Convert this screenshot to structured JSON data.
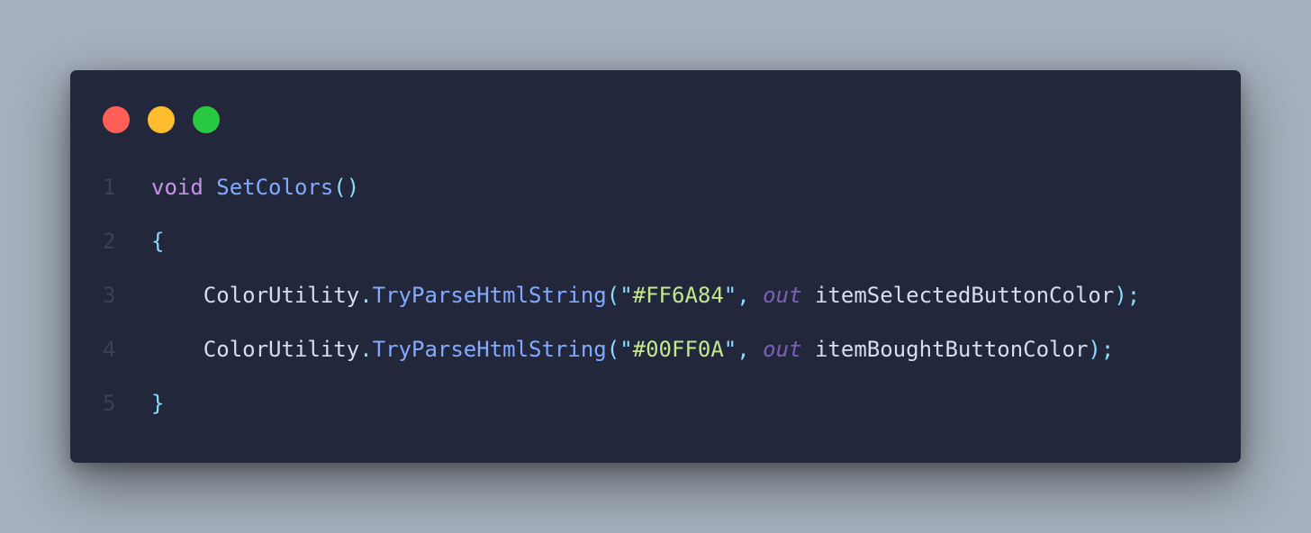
{
  "window": {
    "dots": [
      {
        "name": "close-dot",
        "color": "#ff5f57"
      },
      {
        "name": "minimize-dot",
        "color": "#febc2e"
      },
      {
        "name": "maximize-dot",
        "color": "#28c840"
      }
    ]
  },
  "colors": {
    "background": "#a5b0bc",
    "window": "#22273b",
    "line_number": "#3a4158",
    "keyword": "#c792ea",
    "function": "#82aaff",
    "punctuation": "#89ddff",
    "identifier": "#d6dcf3",
    "string": "#c3e88d"
  },
  "code": {
    "lines": [
      {
        "number": "1",
        "tokens": [
          {
            "t": "void",
            "c": "kw"
          },
          {
            "t": " ",
            "c": "id"
          },
          {
            "t": "SetColors",
            "c": "fn"
          },
          {
            "t": "()",
            "c": "pun"
          }
        ]
      },
      {
        "number": "2",
        "tokens": [
          {
            "t": "{",
            "c": "pun"
          }
        ]
      },
      {
        "number": "3",
        "tokens": [
          {
            "t": "    ",
            "c": "id"
          },
          {
            "t": "ColorUtility",
            "c": "id"
          },
          {
            "t": ".",
            "c": "pun"
          },
          {
            "t": "TryParseHtmlString",
            "c": "fn"
          },
          {
            "t": "(",
            "c": "pun"
          },
          {
            "t": "\"",
            "c": "pun"
          },
          {
            "t": "#FF6A84",
            "c": "str"
          },
          {
            "t": "\"",
            "c": "pun"
          },
          {
            "t": ", ",
            "c": "pun"
          },
          {
            "t": "out",
            "c": "out"
          },
          {
            "t": " ",
            "c": "id"
          },
          {
            "t": "itemSelectedButtonColor",
            "c": "id"
          },
          {
            "t": ");",
            "c": "pun"
          }
        ]
      },
      {
        "number": "4",
        "tokens": [
          {
            "t": "    ",
            "c": "id"
          },
          {
            "t": "ColorUtility",
            "c": "id"
          },
          {
            "t": ".",
            "c": "pun"
          },
          {
            "t": "TryParseHtmlString",
            "c": "fn"
          },
          {
            "t": "(",
            "c": "pun"
          },
          {
            "t": "\"",
            "c": "pun"
          },
          {
            "t": "#00FF0A",
            "c": "str"
          },
          {
            "t": "\"",
            "c": "pun"
          },
          {
            "t": ", ",
            "c": "pun"
          },
          {
            "t": "out",
            "c": "out"
          },
          {
            "t": " ",
            "c": "id"
          },
          {
            "t": "itemBoughtButtonColor",
            "c": "id"
          },
          {
            "t": ");",
            "c": "pun"
          }
        ]
      },
      {
        "number": "5",
        "tokens": [
          {
            "t": "}",
            "c": "pun"
          }
        ]
      }
    ]
  }
}
